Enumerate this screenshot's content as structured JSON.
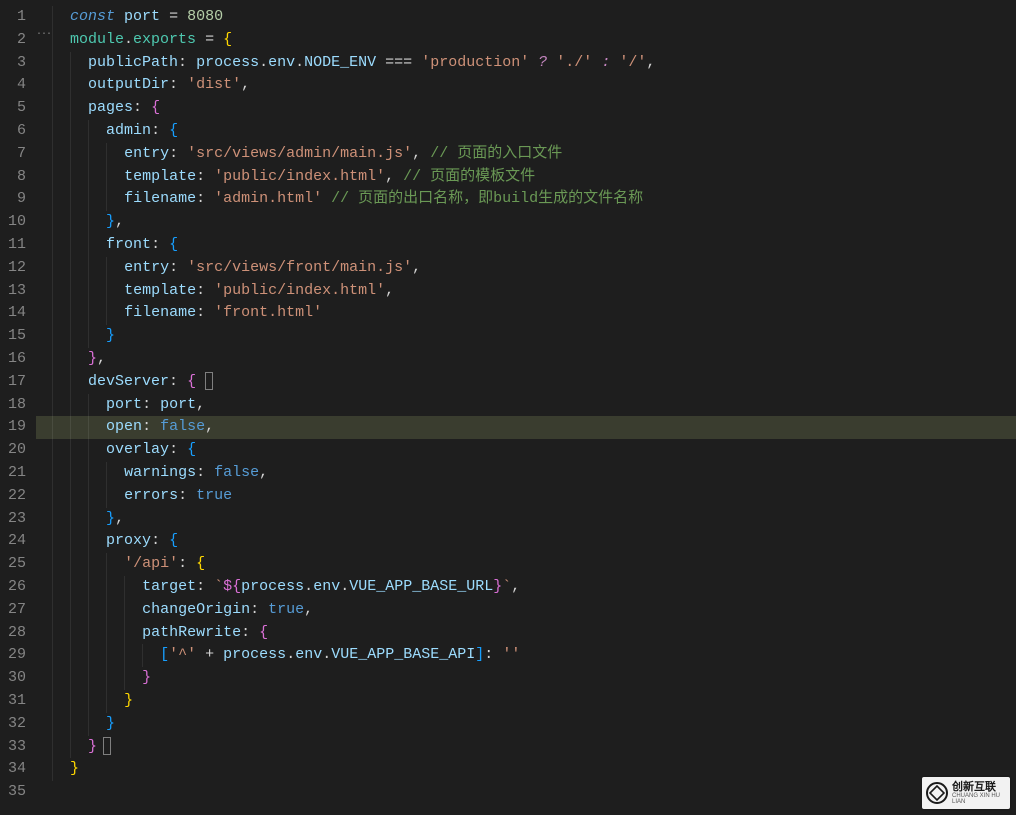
{
  "watermark": {
    "title": "创新互联",
    "subtitle": "CHUANG XIN HU LIAN"
  },
  "gutter_start": 1,
  "gutter_end": 35,
  "highlighted_line": 19,
  "code": {
    "l1": {
      "kw": "const",
      "var": "port",
      "eq": "=",
      "num": "8080"
    },
    "l2": {
      "mod": "module",
      "dot": ".",
      "exp": "exports",
      "eq": "=",
      "brace": "{"
    },
    "l3": {
      "prop": "publicPath",
      "colon": ":",
      "obj": "process",
      "d1": ".",
      "p1": "env",
      "d2": ".",
      "p2": "NODE_ENV",
      "eqeq": "===",
      "s1": "'production'",
      "q": "?",
      "s2": "'./'",
      "col2": ":",
      "s3": "'/'",
      "comma": ","
    },
    "l4": {
      "prop": "outputDir",
      "colon": ":",
      "str": "'dist'",
      "comma": ","
    },
    "l5": {
      "prop": "pages",
      "colon": ":",
      "brace": "{"
    },
    "l6": {
      "prop": "admin",
      "colon": ":",
      "brace": "{"
    },
    "l7": {
      "prop": "entry",
      "colon": ":",
      "str": "'src/views/admin/main.js'",
      "comma": ",",
      "cmt": "// 页面的入口文件"
    },
    "l8": {
      "prop": "template",
      "colon": ":",
      "str": "'public/index.html'",
      "comma": ",",
      "cmt": "// 页面的模板文件"
    },
    "l9": {
      "prop": "filename",
      "colon": ":",
      "str": "'admin.html'",
      "cmt": "// 页面的出口名称，即build生成的文件名称"
    },
    "l10": {
      "brace": "}",
      "comma": ","
    },
    "l11": {
      "prop": "front",
      "colon": ":",
      "brace": "{"
    },
    "l12": {
      "prop": "entry",
      "colon": ":",
      "str": "'src/views/front/main.js'",
      "comma": ","
    },
    "l13": {
      "prop": "template",
      "colon": ":",
      "str": "'public/index.html'",
      "comma": ","
    },
    "l14": {
      "prop": "filename",
      "colon": ":",
      "str": "'front.html'"
    },
    "l15": {
      "brace": "}"
    },
    "l16": {
      "brace": "}",
      "comma": ","
    },
    "l17": {
      "prop": "devServer",
      "colon": ":",
      "brace": "{"
    },
    "l18": {
      "prop": "port",
      "colon": ":",
      "val": "port",
      "comma": ","
    },
    "l19": {
      "prop": "open",
      "colon": ":",
      "bool": "false",
      "comma": ","
    },
    "l20": {
      "prop": "overlay",
      "colon": ":",
      "brace": "{"
    },
    "l21": {
      "prop": "warnings",
      "colon": ":",
      "bool": "false",
      "comma": ","
    },
    "l22": {
      "prop": "errors",
      "colon": ":",
      "bool": "true"
    },
    "l23": {
      "brace": "}",
      "comma": ","
    },
    "l24": {
      "prop": "proxy",
      "colon": ":",
      "brace": "{"
    },
    "l25": {
      "str": "'/api'",
      "colon": ":",
      "brace": "{"
    },
    "l26": {
      "prop": "target",
      "colon": ":",
      "bt1": "`",
      "tpl1": "${",
      "obj": "process",
      "d1": ".",
      "p1": "env",
      "d2": ".",
      "p2": "VUE_APP_BASE_URL",
      "tpl2": "}",
      "bt2": "`",
      "comma": ","
    },
    "l27": {
      "prop": "changeOrigin",
      "colon": ":",
      "bool": "true",
      "comma": ","
    },
    "l28": {
      "prop": "pathRewrite",
      "colon": ":",
      "brace": "{"
    },
    "l29": {
      "lb": "[",
      "s1": "'^'",
      "plus": "+",
      "obj": "process",
      "d1": ".",
      "p1": "env",
      "d2": ".",
      "p2": "VUE_APP_BASE_API",
      "rb": "]",
      "colon": ":",
      "s2": "''"
    },
    "l30": {
      "brace": "}"
    },
    "l31": {
      "brace": "}"
    },
    "l32": {
      "brace": "}"
    },
    "l33": {
      "brace": "}"
    },
    "l34": {
      "brace": "}"
    }
  }
}
